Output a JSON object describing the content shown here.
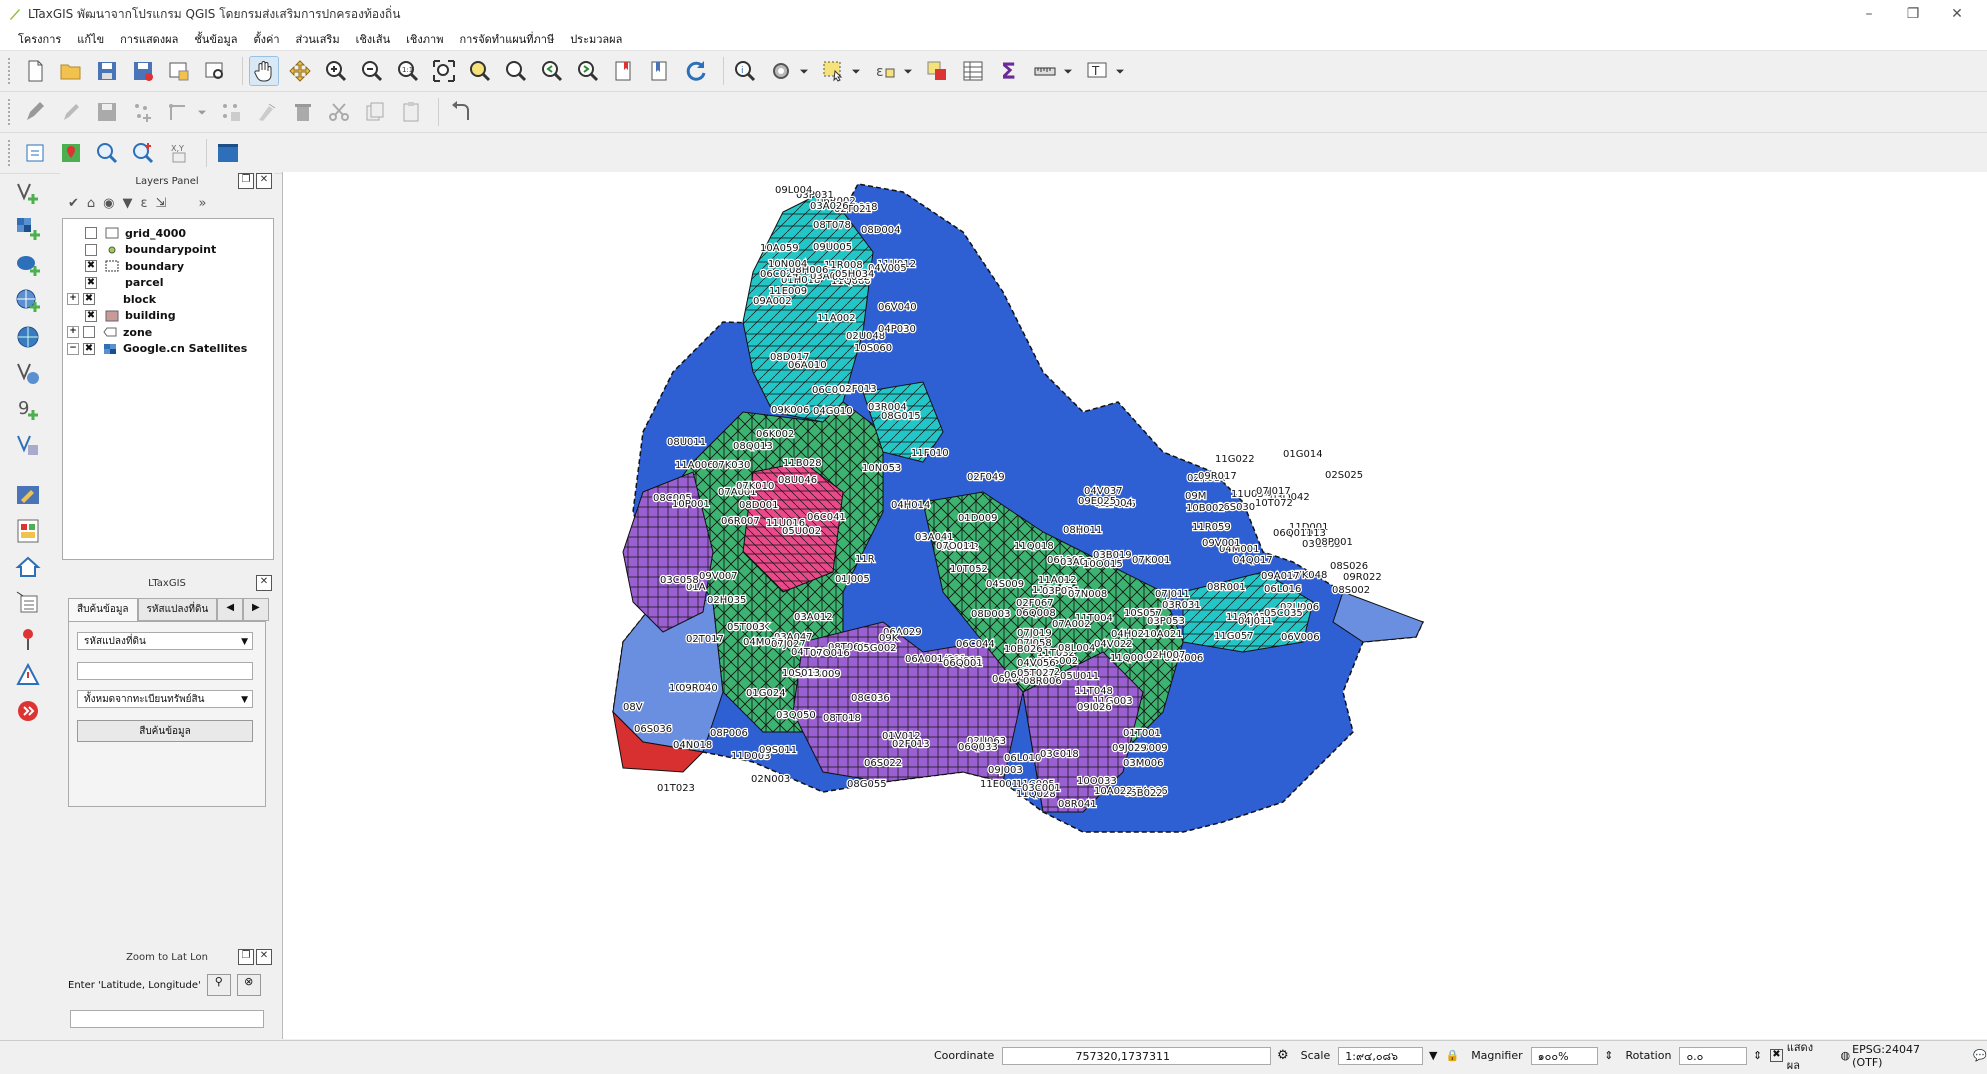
{
  "window": {
    "title": "LTaxGIS พัฒนาจากโปรแกรม QGIS โดยกรมส่งเสริมการปกครองท้องถิ่น",
    "minimize": "–",
    "restore": "❐",
    "close": "✕"
  },
  "menu": [
    "โครงการ",
    "แก้ไข",
    "การแสดงผล",
    "ชั้นข้อมูล",
    "ตั้งค่า",
    "ส่วนเสริม",
    "เชิงเส้น",
    "เชิงภาพ",
    "การจัดทำแผนที่ภาษี",
    "ประมวลผล"
  ],
  "layers_panel": {
    "title": "Layers Panel",
    "layers": [
      {
        "name": "grid_4000",
        "checked": false,
        "expandable": false
      },
      {
        "name": "boundarypoint",
        "checked": false,
        "expandable": false
      },
      {
        "name": "boundary",
        "checked": true,
        "expandable": false
      },
      {
        "name": "parcel",
        "checked": true,
        "expandable": false
      },
      {
        "name": "block",
        "checked": true,
        "expandable": true
      },
      {
        "name": "building",
        "checked": true,
        "expandable": false
      },
      {
        "name": "zone",
        "checked": false,
        "expandable": true
      },
      {
        "name": "Google.cn Satellites",
        "checked": true,
        "expandable": false
      }
    ]
  },
  "ltaxgis_panel": {
    "title": "LTaxGIS",
    "tabs": [
      "สืบค้นข้อมูล",
      "รหัสแปลงที่ดิน"
    ],
    "select1": "รหัสแปลงที่ดิน",
    "input_value": "",
    "select2": "ทั้งหมดจากทะเบียนทรัพย์สิน",
    "search_button": "สืบค้นข้อมูล"
  },
  "zoom_panel": {
    "title": "Zoom to Lat Lon",
    "label": "Enter 'Latitude, Longitude'",
    "input_value": ""
  },
  "status": {
    "coordinate_label": "Coordinate",
    "coordinate_value": "757320,1737311",
    "scale_label": "Scale",
    "scale_value": "1:๙๔,๐๘๖",
    "magnifier_label": "Magnifier",
    "magnifier_value": "๑๐๐%",
    "rotation_label": "Rotation",
    "rotation_value": "๐.๐",
    "render_label": "แสดงผล",
    "crs": "EPSG:24047 (OTF)"
  },
  "map": {
    "labels": [
      "11A002",
      "11A006",
      "11A012",
      "11C005",
      "11D001",
      "11D003",
      "11D008",
      "11B028",
      "11F016",
      "11G003",
      "11G022",
      "11E001",
      "11E009",
      "11F010",
      "11G047",
      "11Q009",
      "11G057",
      "11G068",
      "11R008",
      "01A",
      "11Q018",
      "11Q028",
      "11Q042",
      "01B009",
      "11Q060",
      "11R",
      "01D009",
      "11T004",
      "11R059",
      "01V012",
      "11U012",
      "11U016",
      "11T032",
      "11T048",
      "11U034",
      "06A001/001",
      "06A010",
      "06A029",
      "01N006",
      "01T001",
      "01G014",
      "01G024",
      "01H018",
      "01J005",
      "06A045",
      "06A058",
      "01T013",
      "01T023",
      "06C002",
      "06C041",
      "06C044",
      "02H007",
      "02H014",
      "02F013",
      "02F013",
      "02H035",
      "02F049",
      "02F067",
      "02U006",
      "02U013",
      "06R002",
      "06R007",
      "06R022",
      "06S002",
      "02S025",
      "02T017",
      "02T021",
      "06K002",
      "06L002",
      "06L010",
      "06L016",
      "02N003",
      "02U048",
      "07A001",
      "06Q001",
      "06Q008",
      "06S030",
      "06S036",
      "03A001",
      "03A012",
      "03A022",
      "03C001",
      "03C003",
      "02U063",
      "04G010",
      "04H014",
      "07A002",
      "07A006",
      "06V006",
      "06S022",
      "03A026",
      "03A041",
      "03B019",
      "03M006",
      "06Q011",
      "06Q033",
      "06C024",
      "03A047",
      "03C004",
      "04H022",
      "04M001",
      "04M010",
      "06V040",
      "08C005",
      "08D003",
      "03C018",
      "04J011",
      "08C036",
      "08D004",
      "08D001",
      "07J011",
      "07J019",
      "03Q042",
      "03Q050",
      "03P031",
      "03C058",
      "03P021",
      "03P053",
      "07J017",
      "07J027",
      "08D017",
      "08G015",
      "08H011",
      "08L004",
      "08P001",
      "08P006",
      "03R004",
      "04K",
      "07K001",
      "07J058",
      "08R001",
      "08G055",
      "08H006",
      "08Q013",
      "03R031",
      "05B009",
      "04Q017",
      "04N018",
      "04P030",
      "07K010",
      "07N008",
      "08R006",
      "08S002",
      "08T018",
      "08T032",
      "08U011",
      "08U032",
      "05B022",
      "05C035",
      "04T003",
      "04V005",
      "07K030",
      "07O011",
      "08R041",
      "08S026",
      "08T063",
      "08T078",
      "08U046",
      "04S009",
      "04V022",
      "07K048",
      "07O016",
      "09A002",
      "09K006",
      "04V037",
      "04V056",
      "09A017",
      "09J003",
      "09L004",
      "09K",
      "10A021",
      "10A022",
      "10B002",
      "05G002",
      "05H034",
      "05T003",
      "09E025",
      "09J029",
      "09M",
      "10A043",
      "10A059",
      "05U002",
      "05U011",
      "05T027",
      "09R017",
      "09R040",
      "10N004",
      "10P001",
      "10B026",
      "09I026",
      "09R022",
      "09S011",
      "09U005",
      "10N053",
      "10O015",
      "10O033",
      "09V001",
      "10S013",
      "10S060",
      "09V007",
      "10T052",
      "10S057",
      "10T072",
      "08V"
    ]
  }
}
